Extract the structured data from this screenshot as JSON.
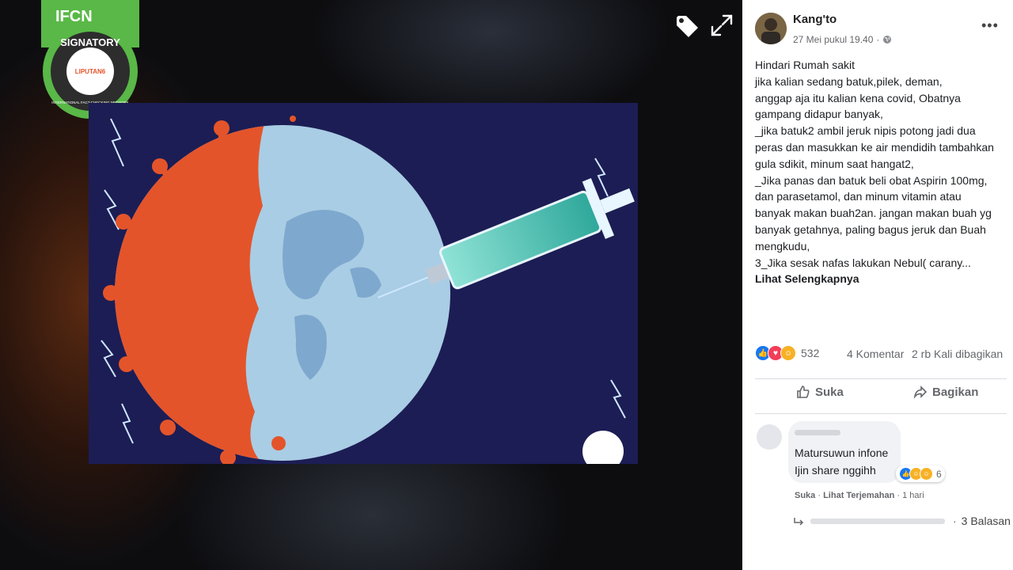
{
  "badge": {
    "logo": "IFCN",
    "tag": "SIGNATORY",
    "ring": "INTERNATIONAL FACT-CHECKING NETWORK",
    "org": "LIPUTAN6"
  },
  "viewer": {
    "tag_icon": "tag-icon",
    "fullscreen_icon": "expand-icon"
  },
  "post": {
    "author": "Kang'to",
    "timestamp": "27 Mei pukul 19.40",
    "lines": [
      "Hindari Rumah sakit",
      "jika kalian sedang batuk,pilek, deman,",
      "anggap aja itu kalian kena covid, Obatnya",
      "gampang didapur banyak,",
      "_jika batuk2 ambil jeruk nipis potong jadi dua",
      "peras dan masukkan ke air mendidih tambahkan",
      "gula sdikit, minum saat hangat2,",
      "_Jika panas dan batuk beli obat Aspirin 100mg,",
      "dan parasetamol, dan minum vitamin atau",
      "banyak makan buah2an. jangan makan buah yg",
      "banyak getahnya, paling bagus jeruk dan Buah",
      "mengkudu,"
    ],
    "last_line": "3_Jika sesak nafas lakukan Nebul( carany...",
    "see_more": "Lihat Selengkapnya",
    "reactions_count": "532",
    "comments": "4 Komentar",
    "shares": "2 rb Kali dibagikan"
  },
  "actions": {
    "like": "Suka",
    "share": "Bagikan"
  },
  "comment": {
    "text_line1": "Matursuwun infone",
    "text_line2": "Ijin share nggihh",
    "reactions_count": "6",
    "like": "Suka",
    "translate": "Lihat Terjemahan",
    "time": "1 hari",
    "replies": "3 Balasan"
  },
  "colors": {
    "like_blue": "#1877f2",
    "love_red": "#f33e58",
    "haha_yellow": "#f7b125",
    "virus_orange": "#e4542a",
    "globe_blue": "#a9cde4",
    "badge_green": "#59b847"
  }
}
